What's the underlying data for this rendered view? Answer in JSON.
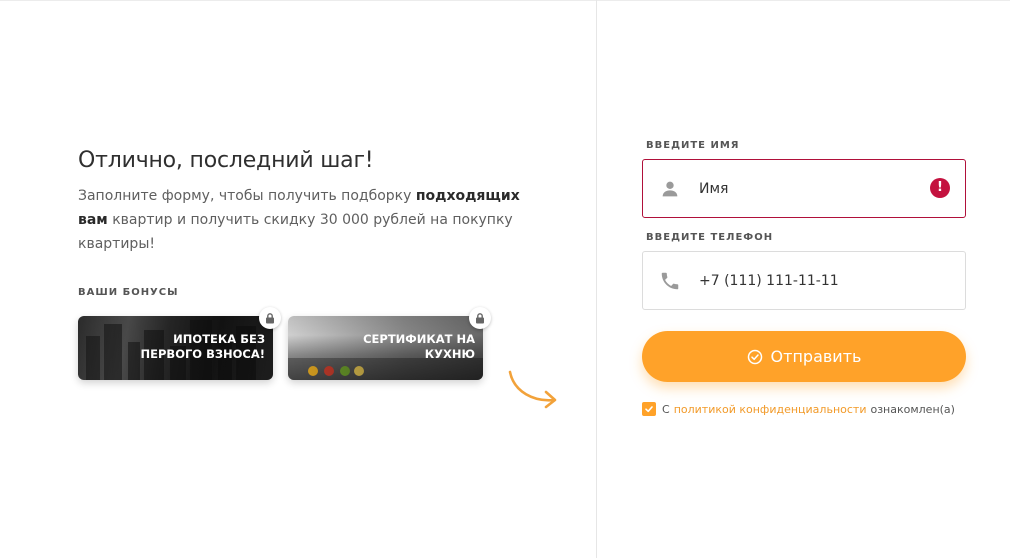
{
  "left": {
    "title": "Отлично, последний шаг!",
    "desc_part1": "Заполните форму, чтобы получить подборку ",
    "desc_bold": "подходящих вам",
    "desc_part2": " квартир и получить скидку 30 000 рублей на покупку квартиры!",
    "bonus_label": "ВАШИ БОНУСЫ",
    "bonuses": [
      {
        "line1": "ИПОТЕКА БЕЗ",
        "line2": "ПЕРВОГО ВЗНОСА!",
        "icon": "lock-icon"
      },
      {
        "line1": "СЕРТИФИКАТ НА",
        "line2": "КУХНЮ",
        "icon": "lock-icon"
      }
    ]
  },
  "form": {
    "name_label": "ВВЕДИТЕ ИМЯ",
    "name_placeholder": "Имя",
    "name_error_icon": "!",
    "phone_label": "ВВЕДИТЕ ТЕЛЕФОН",
    "phone_placeholder": "+7 (111) 111-11-11",
    "submit_label": "Отправить",
    "consent_prefix": "С",
    "consent_link": "политикой конфиденциальности",
    "consent_suffix": "ознакомлен(а)",
    "consent_checked": true
  },
  "colors": {
    "accent": "#ffa229",
    "error": "#c4123f",
    "link": "#f29a29"
  }
}
